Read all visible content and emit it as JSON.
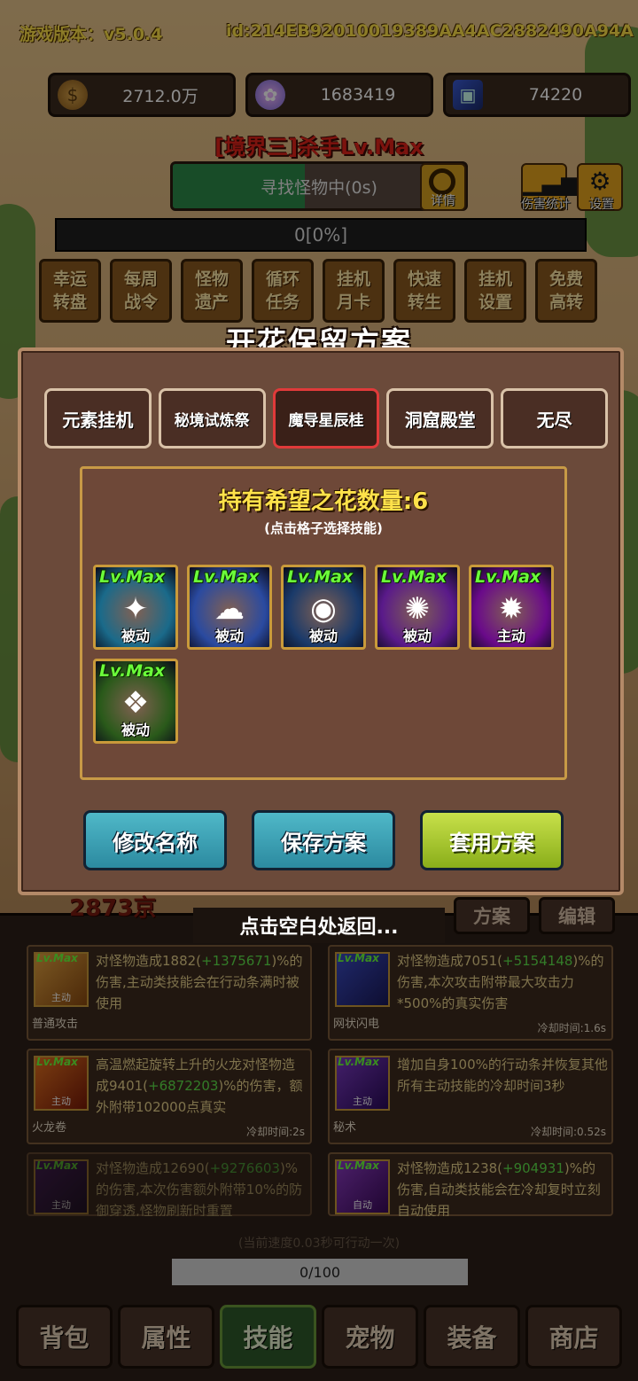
{
  "header": {
    "version": "游戏版本：v5.0.4",
    "user_id": "id:214EB92010019389AA4AC2882490A94A"
  },
  "currencies": [
    {
      "icon": "coin-icon",
      "value": "2712.0万"
    },
    {
      "icon": "lotus-icon",
      "value": "1683419"
    },
    {
      "icon": "card-icon",
      "value": "74220"
    }
  ],
  "realm_title": "[境界三]杀手Lv.Max",
  "search": {
    "status": "寻找怪物中(0s)",
    "progress": 0.45,
    "detail_label": "详情"
  },
  "tools": {
    "damage_stats": "伤害统计",
    "settings": "设置"
  },
  "xp_bar": {
    "text": "0[0%]",
    "progress": 0
  },
  "menu": [
    "幸运\n转盘",
    "每周\n战令",
    "怪物\n遗产",
    "循环\n任务",
    "挂机\n月卡",
    "快速\n转生",
    "挂机\n设置",
    "免费\n高转"
  ],
  "modal": {
    "title": "开花保留方案",
    "tabs": [
      "元素挂机",
      "秘境试炼祭",
      "魔导星辰桂",
      "洞窟殿堂",
      "无尽"
    ],
    "active_tab": 2,
    "flower_count": "持有希望之花数量:6",
    "hint": "(点击格子选择技能)",
    "skills": [
      {
        "level": "Lv.Max",
        "type": "被动",
        "color": "#1a6a8a"
      },
      {
        "level": "Lv.Max",
        "type": "被动",
        "color": "#2a4aa0"
      },
      {
        "level": "Lv.Max",
        "type": "被动",
        "color": "#1a3a6a"
      },
      {
        "level": "Lv.Max",
        "type": "被动",
        "color": "#5a1a8a"
      },
      {
        "level": "Lv.Max",
        "type": "主动",
        "color": "#6a0a8a"
      },
      {
        "level": "Lv.Max",
        "type": "被动",
        "color": "#2a5a1a"
      }
    ],
    "buttons": {
      "rename": "修改名称",
      "save": "保存方案",
      "apply": "套用方案"
    }
  },
  "lower": {
    "damage_partial": "2873京",
    "plan_label": "方案",
    "edit_label": "编辑",
    "back_hint": "点击空白处返回...",
    "cards": [
      {
        "level": "Lv.Max",
        "type": "主动",
        "name": "普通攻击",
        "desc_a": "对怪物造成1882(",
        "desc_g": "+1375671",
        "desc_b": ")%的伤害,主动类技能会在行动条满时被使用",
        "cooldown": ""
      },
      {
        "level": "Lv.Max",
        "type": "",
        "name": "网状闪电",
        "desc_a": "对怪物造成7051(",
        "desc_g": "+5154148",
        "desc_b": ")%的伤害,本次攻击附带最大攻击力*500%的真实伤害",
        "cooldown": "冷却时间:1.6s"
      },
      {
        "level": "Lv.Max",
        "type": "主动",
        "name": "火龙卷",
        "desc_a": "高温燃起旋转上升的火龙对怪物造成9401(",
        "desc_g": "+6872203",
        "desc_b": ")%的伤害，额外附带102000点真实",
        "cooldown": "冷却时间:2s"
      },
      {
        "level": "Lv.Max",
        "type": "主动",
        "name": "秘术",
        "desc_a": "增加自身100%的行动条并恢复其他所有主动技能的冷却时间3秒",
        "desc_g": "",
        "desc_b": "",
        "cooldown": "冷却时间:0.52s"
      },
      {
        "level": "Lv.Max",
        "type": "主动",
        "name": "",
        "desc_a": "对怪物造成12690(",
        "desc_g": "+9276603",
        "desc_b": ")%的伤害,本次伤害额外附带10%的防御穿透,怪物刷新时重置",
        "cooldown": ""
      },
      {
        "level": "Lv.Max",
        "type": "自动",
        "name": "",
        "desc_a": "对怪物造成1238(",
        "desc_g": "+904931",
        "desc_b": ")%的伤害,自动类技能会在冷却复时立刻自动使用",
        "cooldown": ""
      }
    ],
    "speed_text": "(当前速度0.03秒可行动一次)",
    "progress_text": "0/100"
  },
  "bottom_nav": [
    "背包",
    "属性",
    "技能",
    "宠物",
    "装备",
    "商店"
  ],
  "bottom_nav_active": 2
}
